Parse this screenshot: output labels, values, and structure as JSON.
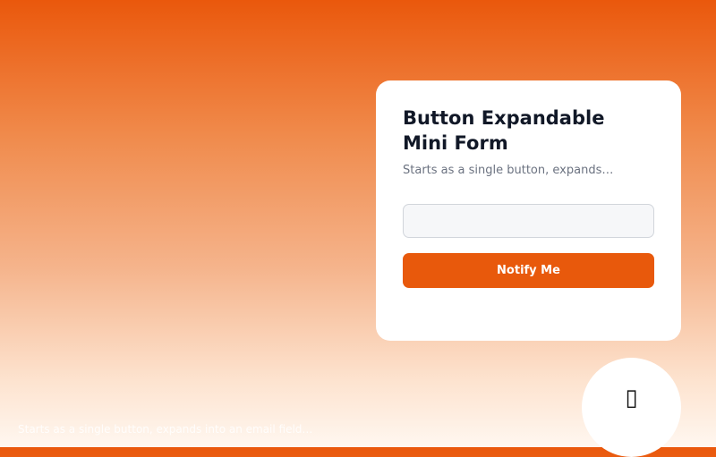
{
  "card": {
    "title": "Button Expandable Mini Form",
    "subtitle": "Starts as a single button, expands…",
    "email_field": {
      "value": "",
      "placeholder": ""
    },
    "submit_label": "Notify Me"
  },
  "fab": {
    "icon_glyph": "▯",
    "icon_name": "missing-glyph-icon"
  },
  "footer": {
    "caption": "Starts as a single button, expands into an email field…"
  },
  "colors": {
    "accent": "#e8590c",
    "gradient_top": "#ea580c",
    "gradient_bottom": "#fff7f0",
    "card_background": "#ffffff",
    "title_text": "#111827",
    "muted_text": "#6b7280"
  }
}
